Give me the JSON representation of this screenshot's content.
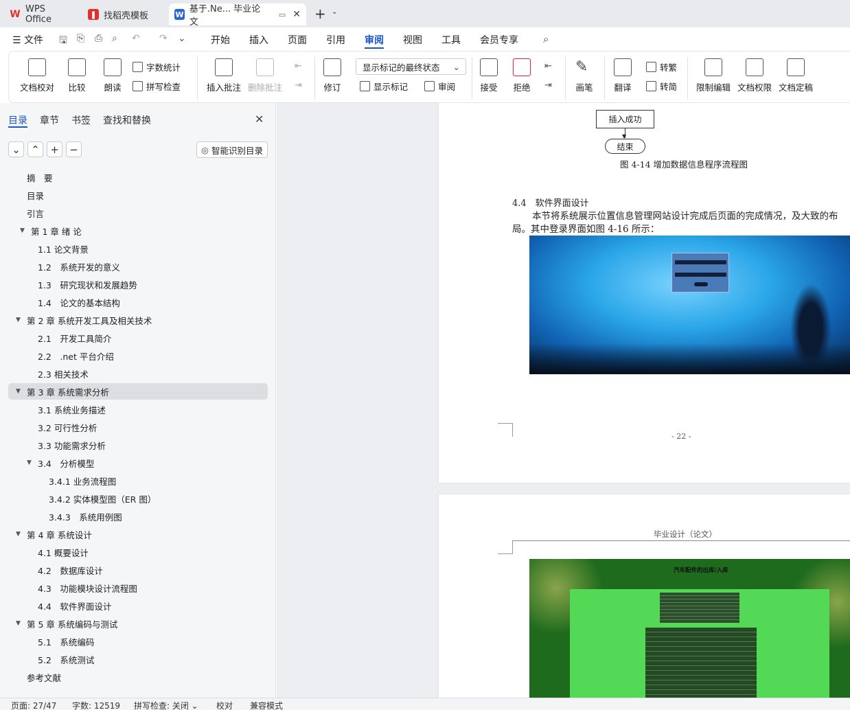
{
  "tabs": {
    "wps_office": "WPS Office",
    "templates": "找稻壳模板",
    "document": "基于.Ne... 毕业论文"
  },
  "menubar": {
    "file": "文件",
    "items": [
      "开始",
      "插入",
      "页面",
      "引用",
      "审阅",
      "视图",
      "工具",
      "会员专享"
    ],
    "active": "审阅"
  },
  "ribbon": {
    "doc_check": "文档校对",
    "compare": "比较",
    "read_aloud": "朗读",
    "word_count": "字数统计",
    "spell_check": "拼写检查",
    "insert_comment": "插入批注",
    "delete_comment": "删除批注",
    "track_changes": "修订",
    "markup_state": "显示标记的最终状态",
    "show_markup": "显示标记",
    "review": "审阅",
    "accept": "接受",
    "reject": "拒绝",
    "pen": "画笔",
    "translate": "翻译",
    "to_traditional": "转繁",
    "to_simplified": "转简",
    "restrict_edit": "限制编辑",
    "doc_permission": "文档权限",
    "finalize": "文档定稿"
  },
  "panel": {
    "tabs": [
      "目录",
      "章节",
      "书签",
      "查找和替换"
    ],
    "smart_toc": "智能识别目录",
    "toc": [
      {
        "label": "摘　要",
        "level": 0,
        "arrow": ""
      },
      {
        "label": "目录",
        "level": 0,
        "arrow": ""
      },
      {
        "label": "引言",
        "level": 0,
        "arrow": ""
      },
      {
        "label": "第 1 章  绪  论",
        "level": 0,
        "arrow": "▼",
        "indent": 1
      },
      {
        "label": "1.1  论文背景",
        "level": 1,
        "arrow": ""
      },
      {
        "label": "1.2　系统开发的意义",
        "level": 1,
        "arrow": ""
      },
      {
        "label": "1.3　研究现状和发展趋势",
        "level": 1,
        "arrow": ""
      },
      {
        "label": "1.4　论文的基本结构",
        "level": 1,
        "arrow": ""
      },
      {
        "label": "第 2 章  系统开发工具及相关技术",
        "level": 0,
        "arrow": "▼"
      },
      {
        "label": "2.1　开发工具简介",
        "level": 1,
        "arrow": ""
      },
      {
        "label": "2.2　.net  平台介绍",
        "level": 1,
        "arrow": ""
      },
      {
        "label": "2.3  相关技术",
        "level": 1,
        "arrow": ""
      },
      {
        "label": "第 3 章  系统需求分析",
        "level": 0,
        "arrow": "▼",
        "selected": true
      },
      {
        "label": "3.1  系统业务描述",
        "level": 1,
        "arrow": ""
      },
      {
        "label": "3.2  可行性分析",
        "level": 1,
        "arrow": ""
      },
      {
        "label": "3.3  功能需求分析",
        "level": 1,
        "arrow": ""
      },
      {
        "label": "3.4　分析模型",
        "level": 1,
        "arrow": "▼"
      },
      {
        "label": "3.4.1  业务流程图",
        "level": 2,
        "arrow": ""
      },
      {
        "label": "3.4.2  实体模型图（ER 图）",
        "level": 2,
        "arrow": ""
      },
      {
        "label": "3.4.3　系统用例图",
        "level": 2,
        "arrow": ""
      },
      {
        "label": "第 4 章  系统设计",
        "level": 0,
        "arrow": "▼"
      },
      {
        "label": "4.1 概要设计",
        "level": 1,
        "arrow": ""
      },
      {
        "label": "4.2　数据库设计",
        "level": 1,
        "arrow": ""
      },
      {
        "label": "4.3　功能模块设计流程图",
        "level": 1,
        "arrow": ""
      },
      {
        "label": "4.4　软件界面设计",
        "level": 1,
        "arrow": ""
      },
      {
        "label": "第 5 章  系统编码与测试",
        "level": 0,
        "arrow": "▼"
      },
      {
        "label": "5.1　系统编码",
        "level": 1,
        "arrow": ""
      },
      {
        "label": "5.2　系统测试",
        "level": 1,
        "arrow": ""
      },
      {
        "label": "参考文献",
        "level": 0,
        "arrow": ""
      }
    ]
  },
  "document": {
    "flow_insert_success": "插入成功",
    "flow_end": "结束",
    "figure_caption": "图 4-14  增加数据信息程序流程图",
    "section_title": "4.4　软件界面设计",
    "paragraph_line1": "本节将系统展示位置信息管理网站设计完成后页面的完成情况，及大致的布",
    "paragraph_line2": "局。其中登录界面如图 4-16 所示：",
    "page_number": "- 22 -",
    "header_text": "毕业设计（论文）",
    "screenshot2_title": "汽车配件的出库/入库"
  },
  "status": {
    "page": "页面: 27/47",
    "words": "字数: 12519",
    "spell": "拼写检查: 关闭",
    "proofread": "校对",
    "compat": "兼容模式"
  },
  "colors": {
    "accent": "#1a56c9",
    "wps_red": "#e0312c",
    "panel_bg": "#f5f6f8",
    "doc_bg": "#eceef1",
    "green_screenshot": "#54d957"
  }
}
